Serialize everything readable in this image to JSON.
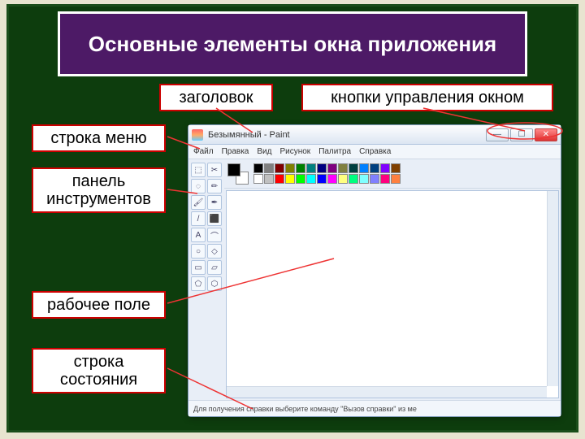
{
  "slide": {
    "title": "Основные элементы окна приложения"
  },
  "labels": {
    "zagolovok": "заголовок",
    "knopki": "кнопки управления окном",
    "menu": "строка меню",
    "panel": "панель инструментов",
    "rab": "рабочее поле",
    "status": "строка состояния"
  },
  "paint": {
    "title": "Безымянный - Paint",
    "menubar": [
      "Файл",
      "Правка",
      "Вид",
      "Рисунок",
      "Палитра",
      "Справка"
    ],
    "status_text": "Для получения справки выберите команду \"Вызов справки\" из ме",
    "win_controls": {
      "min": "—",
      "max": "☐",
      "close": "✕"
    },
    "tools": [
      "⬚",
      "✂",
      "◌",
      "✏",
      "🖌",
      "✒",
      "/",
      "⬛",
      "A",
      "⌒",
      "○",
      "◇",
      "▭",
      "▱",
      "⬠",
      "⬡"
    ],
    "colors_row1": [
      "#000000",
      "#808080",
      "#800000",
      "#808000",
      "#008000",
      "#008080",
      "#000080",
      "#800080",
      "#808040",
      "#004040",
      "#0080ff",
      "#004080",
      "#8000ff",
      "#804000"
    ],
    "colors_row2": [
      "#ffffff",
      "#c0c0c0",
      "#ff0000",
      "#ffff00",
      "#00ff00",
      "#00ffff",
      "#0000ff",
      "#ff00ff",
      "#ffff80",
      "#00ff80",
      "#80ffff",
      "#8080ff",
      "#ff0080",
      "#ff8040"
    ]
  }
}
